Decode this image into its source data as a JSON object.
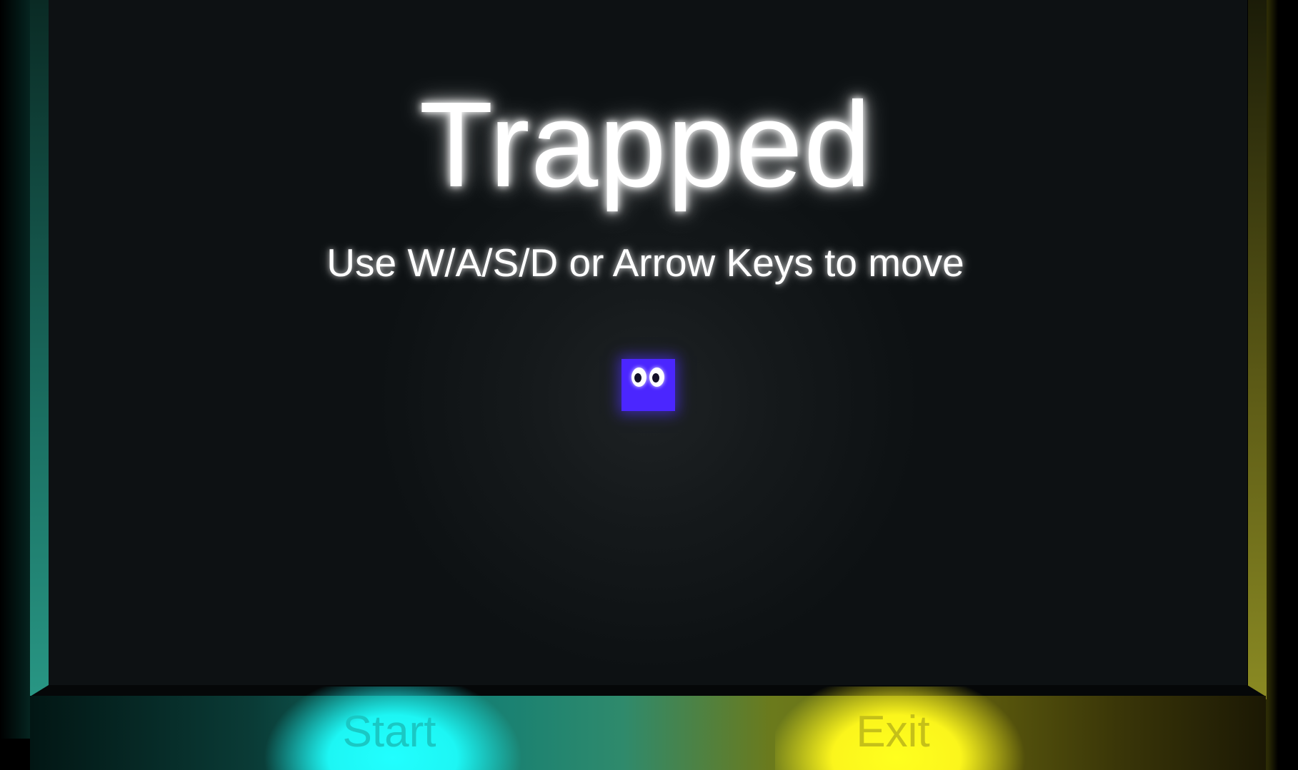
{
  "game": {
    "title": "Trapped",
    "instructions": "Use W/A/S/D or Arrow Keys to move"
  },
  "buttons": {
    "start_label": "Start",
    "exit_label": "Exit"
  },
  "colors": {
    "player": "#4b26ff",
    "start_glow": "#21ffff",
    "exit_glow": "#ffff1e",
    "background": "#0d1113"
  }
}
